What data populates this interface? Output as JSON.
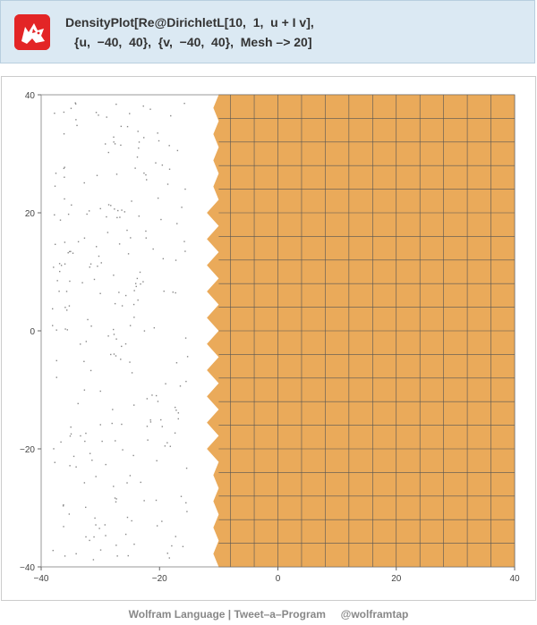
{
  "input": {
    "code_line1": "DensityPlot[Re@DirichletL[10,  1,  u + I v],",
    "code_line2": "{u,  −40,  40},  {v,  −40,  40},  Mesh –> 20]",
    "logo_icon": "wolfram-wolf-icon"
  },
  "footer": {
    "text": "Wolfram Language | Tweet–a–Program     @wolframtap"
  },
  "chart_data": {
    "type": "heatmap",
    "x_range": [
      -40,
      40
    ],
    "y_range": [
      -40,
      40
    ],
    "x_ticks": [
      -40,
      -20,
      0,
      20,
      40
    ],
    "y_ticks": [
      -40,
      -20,
      0,
      20,
      40
    ],
    "x_tick_labels": [
      "−40",
      "−20",
      "0",
      "20",
      "40"
    ],
    "y_tick_labels": [
      "40",
      "20",
      "0",
      "−20",
      "−40"
    ],
    "mesh_lines": 20,
    "fill_color": "#eaaa5a",
    "mesh_color": "#555555",
    "region_boundary_x": -10,
    "boundary_indent_x": -12
  }
}
